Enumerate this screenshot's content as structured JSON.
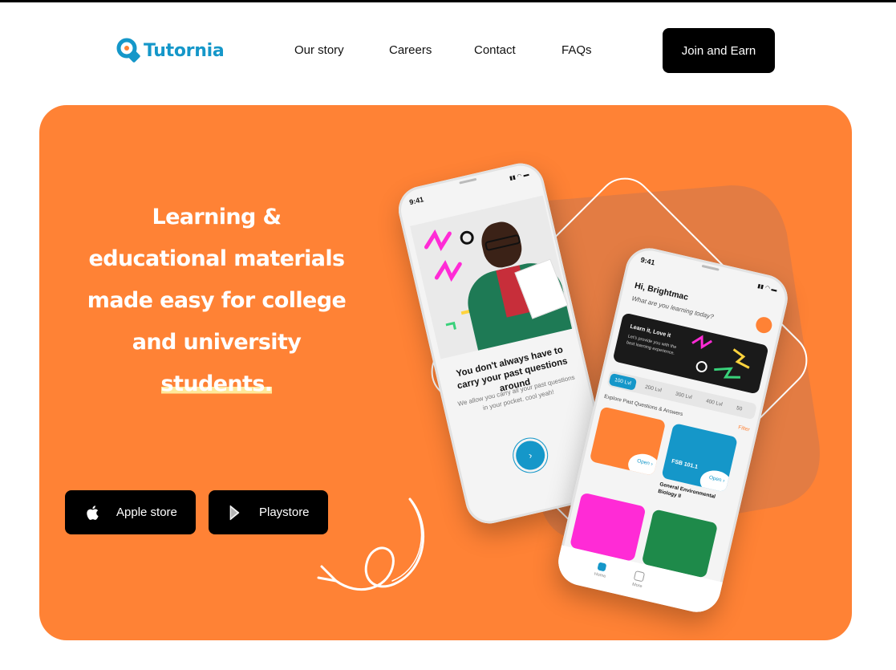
{
  "header": {
    "brand": "Tutornia",
    "nav": [
      "Our story",
      "Careers",
      "Contact",
      "FAQs"
    ],
    "cta": "Join and Earn"
  },
  "hero": {
    "headline_main": "Learning & educational materials made easy for college and university",
    "headline_highlight": "students.",
    "buttons": {
      "apple": "Apple store",
      "play": "Playstore"
    }
  },
  "phone_left": {
    "time": "9:41",
    "title": "You don't always have to carry your past questions around",
    "subtitle": "We allow you carry all your past questions in your pocket. cool yeah!",
    "next_icon": "›"
  },
  "phone_right": {
    "time": "9:41",
    "greeting": "Hi, Brightmac",
    "prompt": "What are you learning today?",
    "banner_title": "Learn it, Love it",
    "banner_text": "Let's provide you with the best learning experience.",
    "levels": [
      "100 Lvl",
      "200 Lvl",
      "300 Lvl",
      "400 Lvl",
      "50"
    ],
    "section": "Explore Past Questions & Answers",
    "filter": "Filter",
    "card_code": "FSB 101.1",
    "open": "Open ›",
    "card_name": "General Environmental Biology II",
    "tabs": [
      "Home",
      "More"
    ]
  },
  "colors": {
    "hero_bg": "#ff8235",
    "brand_blue": "#1597c9",
    "button_bg": "#000000",
    "highlight": "#ffe99a"
  },
  "icons": [
    "tutornia-logo-icon",
    "apple-icon",
    "play-store-icon",
    "arrow-squiggle-icon",
    "chevron-right-icon",
    "home-icon",
    "more-icon"
  ]
}
